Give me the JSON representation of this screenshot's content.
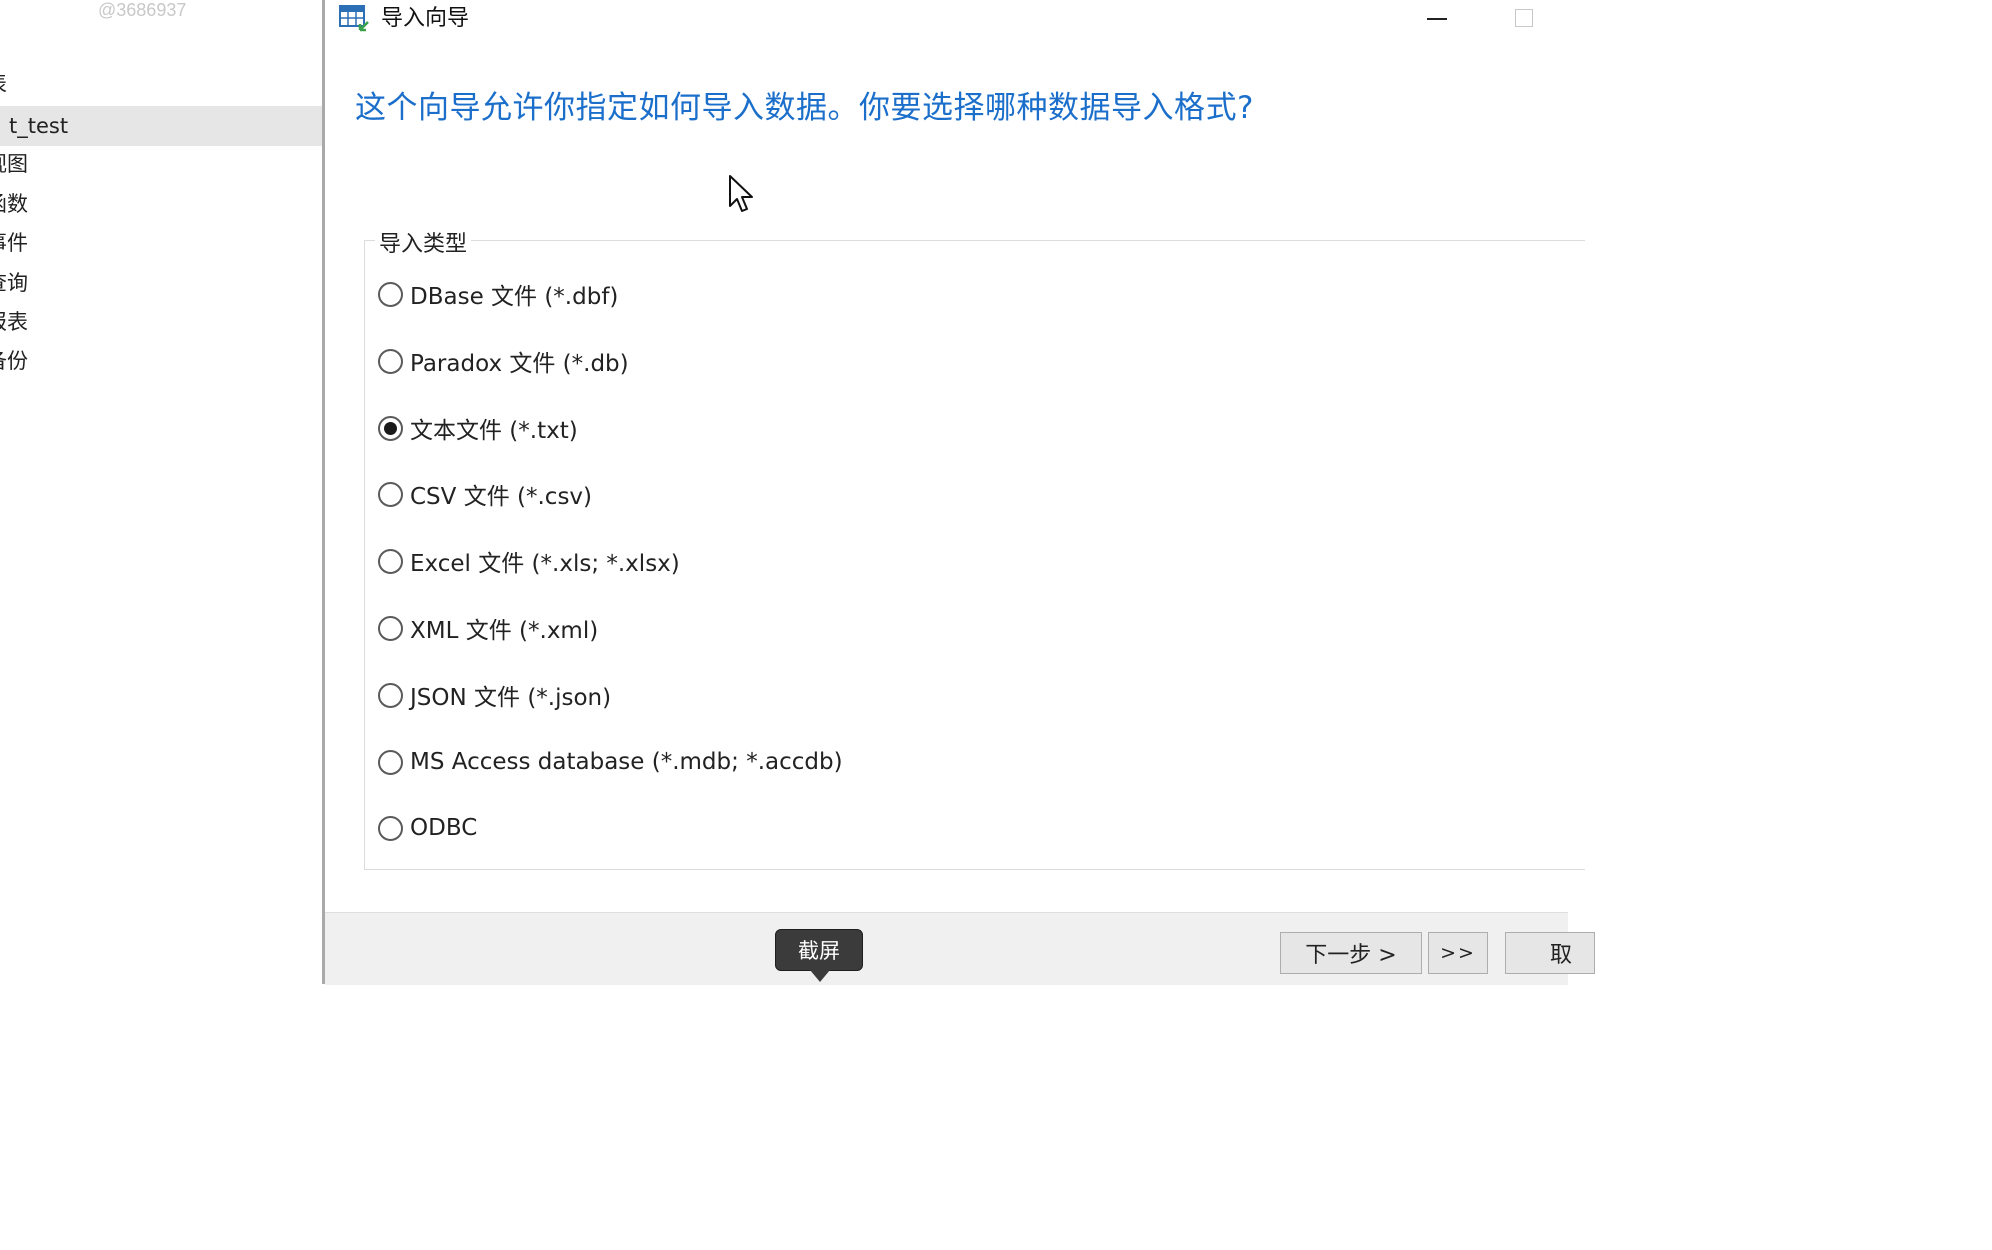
{
  "watermark": "@3686937",
  "navigator": {
    "items": [
      {
        "label": "表",
        "selected": false
      },
      {
        "label": "t_test",
        "selected": true
      },
      {
        "label": "视图",
        "selected": false
      },
      {
        "label": "函数",
        "selected": false
      },
      {
        "label": "事件",
        "selected": false
      },
      {
        "label": "查询",
        "selected": false
      },
      {
        "label": "报表",
        "selected": false
      },
      {
        "label": "备份",
        "selected": false
      }
    ]
  },
  "dialog": {
    "title": "导入向导",
    "heading": "这个向导允许你指定如何导入数据。你要选择哪种数据导入格式?",
    "group_label": "导入类型",
    "options": [
      {
        "label": "DBase 文件 (*.dbf)",
        "checked": false
      },
      {
        "label": "Paradox 文件 (*.db)",
        "checked": false
      },
      {
        "label": "文本文件 (*.txt)",
        "checked": true
      },
      {
        "label": "CSV 文件 (*.csv)",
        "checked": false
      },
      {
        "label": "Excel 文件 (*.xls; *.xlsx)",
        "checked": false
      },
      {
        "label": "XML 文件 (*.xml)",
        "checked": false
      },
      {
        "label": "JSON 文件 (*.json)",
        "checked": false
      },
      {
        "label": "MS Access database (*.mdb; *.accdb)",
        "checked": false
      },
      {
        "label": "ODBC",
        "checked": false
      }
    ],
    "buttons": {
      "next": "下一步 >",
      "finish": ">>",
      "cancel": "取"
    }
  },
  "tooltip": "截屏",
  "colors": {
    "heading": "#1b6fcb",
    "selected_row": "#e6e6e6",
    "footer": "#f0f0f0",
    "tooltip_bg": "#3b3b3b"
  }
}
